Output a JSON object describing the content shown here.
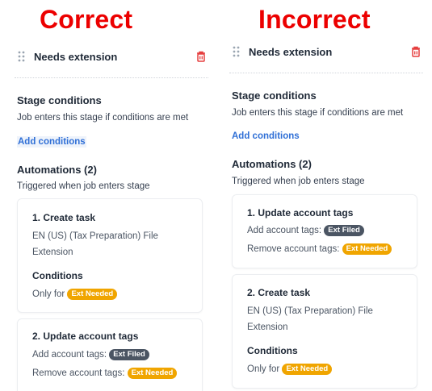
{
  "headings": {
    "correct": "Correct",
    "incorrect": "Incorrect"
  },
  "colors": {
    "heading": "#ec0000",
    "link": "#2f6fd6",
    "tag_filed": "#4b5563",
    "tag_needed": "#f0a500",
    "delete": "#e53e3e"
  },
  "icons": [
    "drag-handle-icon",
    "trash-icon"
  ],
  "common": {
    "stage_name": "Needs extension",
    "stage_conditions_title": "Stage conditions",
    "stage_conditions_desc": "Job enters this stage if conditions are met",
    "add_conditions": "Add conditions",
    "automations_title": "Automations (2)",
    "automations_desc": "Triggered when job enters stage"
  },
  "create_task": {
    "title": "1. Create task",
    "title_second": "2. Create task",
    "desc_line1": "EN (US) (Tax Preparation) File",
    "desc_line2": "Extension",
    "conditions_label": "Conditions",
    "only_for": "Only for",
    "tag": "Ext Needed"
  },
  "update_tags": {
    "title": "2. Update account tags",
    "title_first": "1. Update account tags",
    "add_label": "Add account tags:",
    "add_tag": "Ext Filed",
    "remove_label": "Remove account tags:",
    "remove_tag": "Ext Needed"
  }
}
